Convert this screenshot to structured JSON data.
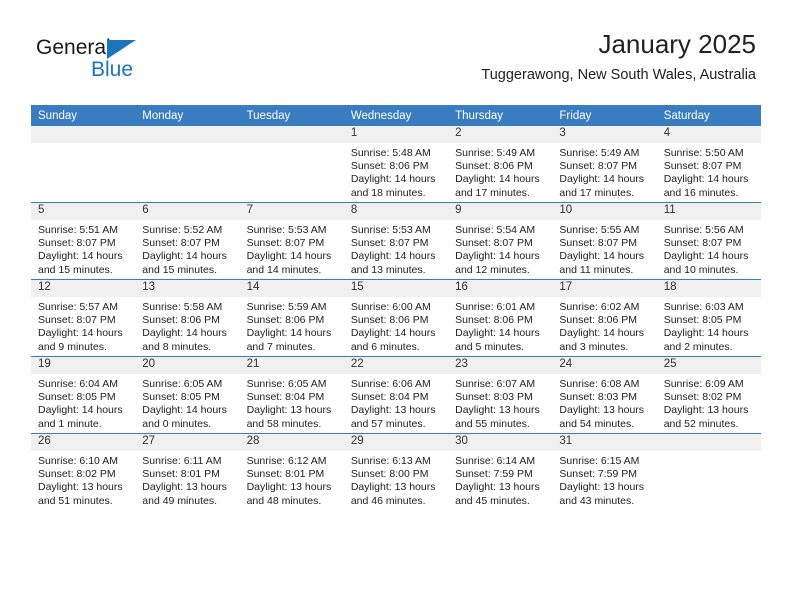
{
  "brand": {
    "name_dark": "General",
    "name_blue": "Blue",
    "accent_color": "#1b75bb"
  },
  "header": {
    "title": "January 2025",
    "subtitle": "Tuggerawong, New South Wales, Australia"
  },
  "theme": {
    "header_row_bg": "#3a7cc0",
    "daynum_band_bg": "#f0f0f0",
    "grid_line": "#3a7cc0"
  },
  "weekday_headers": [
    "Sunday",
    "Monday",
    "Tuesday",
    "Wednesday",
    "Thursday",
    "Friday",
    "Saturday"
  ],
  "weeks": [
    [
      {
        "day": "",
        "sunrise": "",
        "sunset": "",
        "daylight_1": "",
        "daylight_2": ""
      },
      {
        "day": "",
        "sunrise": "",
        "sunset": "",
        "daylight_1": "",
        "daylight_2": ""
      },
      {
        "day": "",
        "sunrise": "",
        "sunset": "",
        "daylight_1": "",
        "daylight_2": ""
      },
      {
        "day": "1",
        "sunrise": "Sunrise: 5:48 AM",
        "sunset": "Sunset: 8:06 PM",
        "daylight_1": "Daylight: 14 hours",
        "daylight_2": "and 18 minutes."
      },
      {
        "day": "2",
        "sunrise": "Sunrise: 5:49 AM",
        "sunset": "Sunset: 8:06 PM",
        "daylight_1": "Daylight: 14 hours",
        "daylight_2": "and 17 minutes."
      },
      {
        "day": "3",
        "sunrise": "Sunrise: 5:49 AM",
        "sunset": "Sunset: 8:07 PM",
        "daylight_1": "Daylight: 14 hours",
        "daylight_2": "and 17 minutes."
      },
      {
        "day": "4",
        "sunrise": "Sunrise: 5:50 AM",
        "sunset": "Sunset: 8:07 PM",
        "daylight_1": "Daylight: 14 hours",
        "daylight_2": "and 16 minutes."
      }
    ],
    [
      {
        "day": "5",
        "sunrise": "Sunrise: 5:51 AM",
        "sunset": "Sunset: 8:07 PM",
        "daylight_1": "Daylight: 14 hours",
        "daylight_2": "and 15 minutes."
      },
      {
        "day": "6",
        "sunrise": "Sunrise: 5:52 AM",
        "sunset": "Sunset: 8:07 PM",
        "daylight_1": "Daylight: 14 hours",
        "daylight_2": "and 15 minutes."
      },
      {
        "day": "7",
        "sunrise": "Sunrise: 5:53 AM",
        "sunset": "Sunset: 8:07 PM",
        "daylight_1": "Daylight: 14 hours",
        "daylight_2": "and 14 minutes."
      },
      {
        "day": "8",
        "sunrise": "Sunrise: 5:53 AM",
        "sunset": "Sunset: 8:07 PM",
        "daylight_1": "Daylight: 14 hours",
        "daylight_2": "and 13 minutes."
      },
      {
        "day": "9",
        "sunrise": "Sunrise: 5:54 AM",
        "sunset": "Sunset: 8:07 PM",
        "daylight_1": "Daylight: 14 hours",
        "daylight_2": "and 12 minutes."
      },
      {
        "day": "10",
        "sunrise": "Sunrise: 5:55 AM",
        "sunset": "Sunset: 8:07 PM",
        "daylight_1": "Daylight: 14 hours",
        "daylight_2": "and 11 minutes."
      },
      {
        "day": "11",
        "sunrise": "Sunrise: 5:56 AM",
        "sunset": "Sunset: 8:07 PM",
        "daylight_1": "Daylight: 14 hours",
        "daylight_2": "and 10 minutes."
      }
    ],
    [
      {
        "day": "12",
        "sunrise": "Sunrise: 5:57 AM",
        "sunset": "Sunset: 8:07 PM",
        "daylight_1": "Daylight: 14 hours",
        "daylight_2": "and 9 minutes."
      },
      {
        "day": "13",
        "sunrise": "Sunrise: 5:58 AM",
        "sunset": "Sunset: 8:06 PM",
        "daylight_1": "Daylight: 14 hours",
        "daylight_2": "and 8 minutes."
      },
      {
        "day": "14",
        "sunrise": "Sunrise: 5:59 AM",
        "sunset": "Sunset: 8:06 PM",
        "daylight_1": "Daylight: 14 hours",
        "daylight_2": "and 7 minutes."
      },
      {
        "day": "15",
        "sunrise": "Sunrise: 6:00 AM",
        "sunset": "Sunset: 8:06 PM",
        "daylight_1": "Daylight: 14 hours",
        "daylight_2": "and 6 minutes."
      },
      {
        "day": "16",
        "sunrise": "Sunrise: 6:01 AM",
        "sunset": "Sunset: 8:06 PM",
        "daylight_1": "Daylight: 14 hours",
        "daylight_2": "and 5 minutes."
      },
      {
        "day": "17",
        "sunrise": "Sunrise: 6:02 AM",
        "sunset": "Sunset: 8:06 PM",
        "daylight_1": "Daylight: 14 hours",
        "daylight_2": "and 3 minutes."
      },
      {
        "day": "18",
        "sunrise": "Sunrise: 6:03 AM",
        "sunset": "Sunset: 8:05 PM",
        "daylight_1": "Daylight: 14 hours",
        "daylight_2": "and 2 minutes."
      }
    ],
    [
      {
        "day": "19",
        "sunrise": "Sunrise: 6:04 AM",
        "sunset": "Sunset: 8:05 PM",
        "daylight_1": "Daylight: 14 hours",
        "daylight_2": "and 1 minute."
      },
      {
        "day": "20",
        "sunrise": "Sunrise: 6:05 AM",
        "sunset": "Sunset: 8:05 PM",
        "daylight_1": "Daylight: 14 hours",
        "daylight_2": "and 0 minutes."
      },
      {
        "day": "21",
        "sunrise": "Sunrise: 6:05 AM",
        "sunset": "Sunset: 8:04 PM",
        "daylight_1": "Daylight: 13 hours",
        "daylight_2": "and 58 minutes."
      },
      {
        "day": "22",
        "sunrise": "Sunrise: 6:06 AM",
        "sunset": "Sunset: 8:04 PM",
        "daylight_1": "Daylight: 13 hours",
        "daylight_2": "and 57 minutes."
      },
      {
        "day": "23",
        "sunrise": "Sunrise: 6:07 AM",
        "sunset": "Sunset: 8:03 PM",
        "daylight_1": "Daylight: 13 hours",
        "daylight_2": "and 55 minutes."
      },
      {
        "day": "24",
        "sunrise": "Sunrise: 6:08 AM",
        "sunset": "Sunset: 8:03 PM",
        "daylight_1": "Daylight: 13 hours",
        "daylight_2": "and 54 minutes."
      },
      {
        "day": "25",
        "sunrise": "Sunrise: 6:09 AM",
        "sunset": "Sunset: 8:02 PM",
        "daylight_1": "Daylight: 13 hours",
        "daylight_2": "and 52 minutes."
      }
    ],
    [
      {
        "day": "26",
        "sunrise": "Sunrise: 6:10 AM",
        "sunset": "Sunset: 8:02 PM",
        "daylight_1": "Daylight: 13 hours",
        "daylight_2": "and 51 minutes."
      },
      {
        "day": "27",
        "sunrise": "Sunrise: 6:11 AM",
        "sunset": "Sunset: 8:01 PM",
        "daylight_1": "Daylight: 13 hours",
        "daylight_2": "and 49 minutes."
      },
      {
        "day": "28",
        "sunrise": "Sunrise: 6:12 AM",
        "sunset": "Sunset: 8:01 PM",
        "daylight_1": "Daylight: 13 hours",
        "daylight_2": "and 48 minutes."
      },
      {
        "day": "29",
        "sunrise": "Sunrise: 6:13 AM",
        "sunset": "Sunset: 8:00 PM",
        "daylight_1": "Daylight: 13 hours",
        "daylight_2": "and 46 minutes."
      },
      {
        "day": "30",
        "sunrise": "Sunrise: 6:14 AM",
        "sunset": "Sunset: 7:59 PM",
        "daylight_1": "Daylight: 13 hours",
        "daylight_2": "and 45 minutes."
      },
      {
        "day": "31",
        "sunrise": "Sunrise: 6:15 AM",
        "sunset": "Sunset: 7:59 PM",
        "daylight_1": "Daylight: 13 hours",
        "daylight_2": "and 43 minutes."
      },
      {
        "day": "",
        "sunrise": "",
        "sunset": "",
        "daylight_1": "",
        "daylight_2": ""
      }
    ]
  ]
}
